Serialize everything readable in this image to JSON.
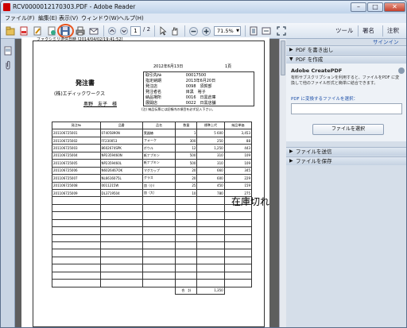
{
  "window": {
    "title": "RCV00000121 70303.PDF - Adobe Reader",
    "title_raw": "RCV000001217030 3.PDF - Adobe Reader"
  },
  "window_title": "RCV0000012170303.PDF - Adobe Reader",
  "controls": {
    "minimize": "–",
    "maximize": "□",
    "close": "✕"
  },
  "menu": [
    "ファイル(F)",
    "編集(E)",
    "表示(V)",
    "ウィンドウ(W)",
    "ヘルプ(H)"
  ],
  "toolbar": {
    "page_current": "1",
    "page_total": "/ 2",
    "zoom": "71.5%",
    "tools": "ツール",
    "sign": "署名",
    "comment": "注釈"
  },
  "signin": "サインイン",
  "panel": {
    "export_pdf": "PDF を書き出し",
    "create_pdf": "PDF を作成",
    "create_title": "Adobe CreatePDF",
    "create_desc": "有料サブスクリプションを利用すると、ファイルをPDF に変換して他のファイル形式と簡単に結合できます。",
    "convert_label": "PDF に変換するファイルを選択：",
    "select_button": "ファイルを選択",
    "send_files": "ファイルを送信",
    "store_files": "ファイルを保存"
  },
  "doc": {
    "fax_header": "ファクシミリ送信日時 [2014/04/02/19:41:52]",
    "date": "2012年6月13日",
    "page": "1頁",
    "title": "発注書",
    "company": "(株)エディックワークス",
    "person": "奥野　友子　様",
    "info": [
      {
        "k": "取引先№",
        "v": "00017500"
      },
      {
        "k": "指定納期",
        "v": "2013年6月20日"
      },
      {
        "k": "発注店",
        "v": "0098　須賀部"
      },
      {
        "k": "発注者名",
        "v": "目黒　裕子"
      },
      {
        "k": "納品場所",
        "v": "0016　日黒倉庫"
      },
      {
        "k": "展開店",
        "v": "0022　日黒店舗"
      }
    ],
    "note": "(注) 納品伝票には記帳内の項目を必ず記入下さい。",
    "headers": [
      "発注№",
      "品番",
      "品名",
      "数量",
      "標準上代",
      "納品単価"
    ],
    "rows": [
      [
        "201106725001",
        "07405890N",
        "実器椿",
        "1",
        "5 600",
        "3,453"
      ],
      [
        "201106725002",
        "FF230053",
        "フォーク",
        "300",
        "250",
        "88"
      ],
      [
        "201106725003",
        "8602674SPK",
        "ボウル",
        "12",
        "1,250",
        "443"
      ],
      [
        "201106725004",
        "NP2359460N",
        "紙ナプキン",
        "500",
        "310",
        "109"
      ],
      [
        "201106725005",
        "NP2359460L",
        "紙ナプキン",
        "500",
        "310",
        "109"
      ],
      [
        "201106725006",
        "N6026467OK",
        "マグカップ",
        "20",
        "660",
        "345"
      ],
      [
        "201106725007",
        "NL6616075L",
        "グラス",
        "20",
        "600",
        "229"
      ],
      [
        "201106725008",
        "0011215W",
        "皿（小）",
        "25",
        "450",
        "159"
      ],
      [
        "201106725009",
        "DL3719504",
        "皿（大）",
        "10",
        "780",
        "275"
      ]
    ],
    "empty_rows": 12,
    "total_label": "合　計",
    "total_value": "1,350",
    "annotation": "在庫切れ"
  }
}
